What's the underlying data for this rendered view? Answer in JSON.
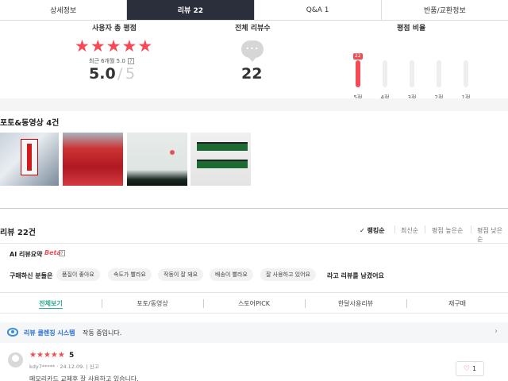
{
  "tabs": [
    {
      "label": "상세정보"
    },
    {
      "label": "리뷰 22"
    },
    {
      "label": "Q&A 1"
    },
    {
      "label": "반품/교환정보"
    }
  ],
  "summary": {
    "rating_title": "사용자 총 평점",
    "recent_label": "최근 6개월 5.0",
    "help_icon": "?",
    "score": "5.0",
    "score_separator": "/",
    "score_max": "5",
    "total_title": "전체 리뷰수",
    "total_count": "22",
    "dist_title": "평점 비율",
    "dist_badge": "22",
    "distribution": [
      {
        "label": "5점",
        "fraction": 1.0
      },
      {
        "label": "4점",
        "fraction": 0
      },
      {
        "label": "3점",
        "fraction": 0
      },
      {
        "label": "2점",
        "fraction": 0
      },
      {
        "label": "1점",
        "fraction": 0
      }
    ]
  },
  "photos": {
    "title": "포토&동영상 4건"
  },
  "reviews": {
    "title": "리뷰 22건",
    "sort_options": [
      {
        "label": "✓ 랭킹순"
      },
      {
        "label": "최신순"
      },
      {
        "label": "평점 높은순"
      },
      {
        "label": "평점 낮은순"
      }
    ],
    "ai_title": "AI 리뷰요약",
    "ai_beta": "Beta",
    "keyword_lead": "구매하신 분들은",
    "keywords": [
      "품질이 좋아요",
      "속도가 빨라요",
      "작동이 잘 돼요",
      "배송이 빨라요",
      "잘 사용하고 있어요"
    ],
    "keyword_tail": "라고 리뷰를 남겼어요",
    "filter_tabs": [
      {
        "label": "전체보기"
      },
      {
        "label": "포토/동영상"
      },
      {
        "label": "스토어PICK"
      },
      {
        "label": "한달사용리뷰"
      },
      {
        "label": "재구매"
      }
    ],
    "notice_highlight": "리뷰 클렌징 시스템",
    "notice_rest": "작동 중입니다.",
    "notice_chevron": "›",
    "first_review": {
      "stars": 5,
      "score": "5",
      "user": "kdy7*****",
      "date": "24.12.09.",
      "report": "신고",
      "body": "메모리카드 교체후 잘 사용하고 있습니다.",
      "likes": "1"
    }
  },
  "colors": {
    "accent": "#f44b55",
    "active_tab_bg": "#2b2e3b",
    "filter_active": "#2aa98c",
    "notice_link": "#2b6fd1"
  }
}
